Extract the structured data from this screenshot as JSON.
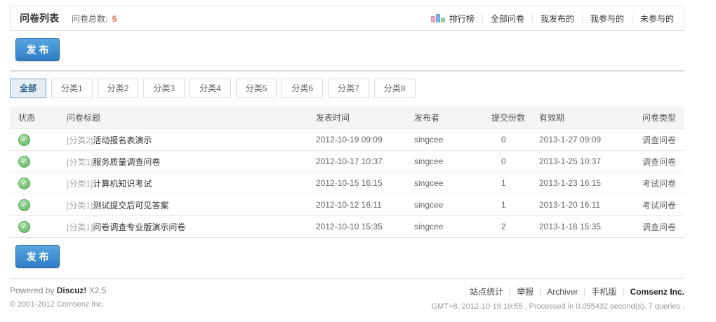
{
  "header": {
    "title": "问卷列表",
    "total_label": "问卷总数:",
    "total_value": "5",
    "nav": [
      {
        "name": "nav-ranking",
        "label": "排行榜",
        "icon": "ranking-chart-icon"
      },
      {
        "name": "nav-all-surveys",
        "label": "全部问卷"
      },
      {
        "name": "nav-my-published",
        "label": "我发布的"
      },
      {
        "name": "nav-my-participated",
        "label": "我参与的"
      },
      {
        "name": "nav-not-participated",
        "label": "未参与的"
      }
    ]
  },
  "publish_button_label": "发布",
  "tabs": [
    {
      "name": "tab-all",
      "label": "全部",
      "active": true
    },
    {
      "name": "tab-category-1",
      "label": "分类1",
      "active": false
    },
    {
      "name": "tab-category-2",
      "label": "分类2",
      "active": false
    },
    {
      "name": "tab-category-3",
      "label": "分类3",
      "active": false
    },
    {
      "name": "tab-category-4",
      "label": "分类4",
      "active": false
    },
    {
      "name": "tab-category-5",
      "label": "分类5",
      "active": false
    },
    {
      "name": "tab-category-6",
      "label": "分类6",
      "active": false
    },
    {
      "name": "tab-category-7",
      "label": "分类7",
      "active": false
    },
    {
      "name": "tab-category-8",
      "label": "分类8",
      "active": false
    }
  ],
  "table": {
    "columns": [
      "状态",
      "问卷标题",
      "发表时间",
      "发布者",
      "提交份数",
      "有效期",
      "问卷类型"
    ],
    "rows": [
      {
        "status": "valid",
        "category": "[分类2]",
        "title": "活动报名表演示",
        "time": "2012-10-19 09:09",
        "publisher": "singcee",
        "submissions": "0",
        "validity": "2013-1-27 09:09",
        "type": "调查问卷"
      },
      {
        "status": "valid",
        "category": "[分类1]",
        "title": "服务质量调查问卷",
        "time": "2012-10-17 10:37",
        "publisher": "singcee",
        "submissions": "0",
        "validity": "2013-1-25 10:37",
        "type": "调查问卷"
      },
      {
        "status": "valid",
        "category": "[分类1]",
        "title": "计算机知识考试",
        "time": "2012-10-15 16:15",
        "publisher": "singcee",
        "submissions": "1",
        "validity": "2013-1-23 16:15",
        "type": "考试问卷"
      },
      {
        "status": "valid",
        "category": "[分类1]",
        "title": "测试提交后可见答案",
        "time": "2012-10-12 16:11",
        "publisher": "singcee",
        "submissions": "1",
        "validity": "2013-1-20 16:11",
        "type": "考试问卷"
      },
      {
        "status": "valid",
        "category": "[分类1]",
        "title": "问卷调查专业版演示问卷",
        "time": "2012-10-10 15:35",
        "publisher": "singcee",
        "submissions": "2",
        "validity": "2013-1-18 15:35",
        "type": "调查问卷"
      }
    ]
  },
  "footer": {
    "powered_prefix": "Powered by",
    "powered_brand": "Discuz!",
    "powered_version": "X2.5",
    "copyright": "© 2001-2012 Comsenz Inc.",
    "links": [
      {
        "name": "footer-site-stats",
        "label": "站点统计",
        "bold": false
      },
      {
        "name": "footer-report",
        "label": "举报",
        "bold": false
      },
      {
        "name": "footer-archiver",
        "label": "Archiver",
        "bold": false
      },
      {
        "name": "footer-mobile-version",
        "label": "手机版",
        "bold": false
      },
      {
        "name": "footer-comsenz",
        "label": "Comsenz Inc.",
        "bold": true
      }
    ],
    "stats_line": "GMT+8, 2012-10-19 10:55 , Processed in 0.055432 second(s), 7 queries ."
  },
  "icons": {
    "status_ok": "✓"
  },
  "colors": {
    "accent_blue": "#2E7CC6",
    "accent_blue_light": "#58A7E0",
    "count_red": "#F26C4F",
    "status_green": "#57B257",
    "tab_active_text": "#2E618C",
    "tab_active_bg": "#E6EEF5",
    "tab_active_border": "#7E9DB9"
  }
}
